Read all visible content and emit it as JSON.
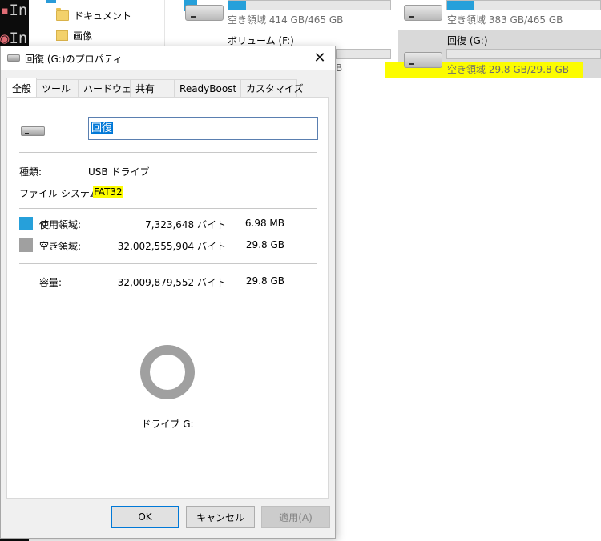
{
  "background": {
    "terminal_lines": [
      "Ins",
      "Ins"
    ],
    "nav_items": [
      {
        "label": "ドキュメント",
        "icon": "folder-icon"
      },
      {
        "label": "画像",
        "icon": "pictures-folder-icon"
      }
    ],
    "drives": [
      {
        "free_text": "空き領域 414 GB/465 GB",
        "used_fraction": 0.11
      },
      {
        "free_text": "空き領域 383 GB/465 GB",
        "used_fraction": 0.18
      },
      {
        "title": "ボリューム (F:)",
        "free_text_partial": "B"
      },
      {
        "title": "回復 (G:)",
        "free_text": "空き領域 29.8 GB/29.8 GB",
        "used_fraction": 0.0
      }
    ]
  },
  "dialog": {
    "title": "回復 (G:)のプロパティ",
    "close_label": "✕",
    "tabs": [
      "全般",
      "ツール",
      "ハードウェア",
      "共有",
      "ReadyBoost",
      "カスタマイズ"
    ],
    "active_tab": "全般",
    "drive_name": "回復",
    "type_label": "種類:",
    "type_value": "USB ドライブ",
    "fs_label": "ファイル システム:",
    "fs_value": "FAT32",
    "used": {
      "label": "使用領域:",
      "bytes": "7,323,648 バイト",
      "size": "6.98 MB",
      "color": "#26a0da"
    },
    "free": {
      "label": "空き領域:",
      "bytes": "32,002,555,904 バイト",
      "size": "29.8 GB",
      "color": "#a0a0a0"
    },
    "capacity": {
      "label": "容量:",
      "bytes": "32,009,879,552 バイト",
      "size": "29.8 GB"
    },
    "drive_label": "ドライブ G:",
    "buttons": {
      "ok": "OK",
      "cancel": "キャンセル",
      "apply": "適用(A)"
    }
  }
}
